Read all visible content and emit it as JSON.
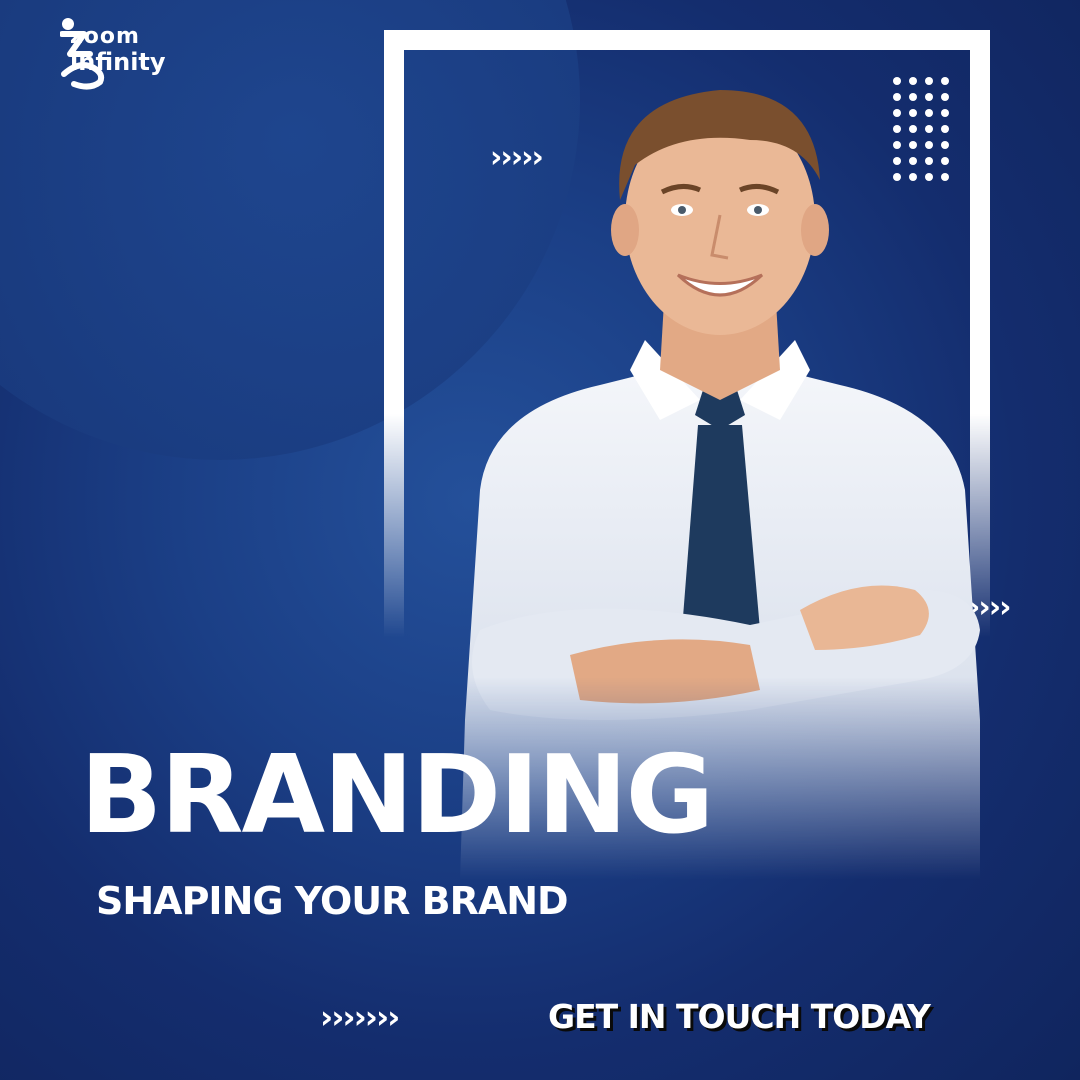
{
  "brand": {
    "name_line1": "zoom",
    "name_line2": "infinity",
    "logo_icon": "zoom-infinity-logo-icon"
  },
  "headline": "BRANDING",
  "subheadline": "SHAPING YOUR BRAND",
  "cta": {
    "label": "GET IN TOUCH TODAY"
  },
  "decor": {
    "chevrons_top": "›››››",
    "chevrons_right": "››››",
    "chevrons_bottom": "›››››››"
  },
  "colors": {
    "background": "#17367a",
    "accent_white": "#ffffff",
    "shirt": "#e8ecf4",
    "tie": "#1e3a5e"
  },
  "image": {
    "subject": "smiling-businessman-photo"
  }
}
